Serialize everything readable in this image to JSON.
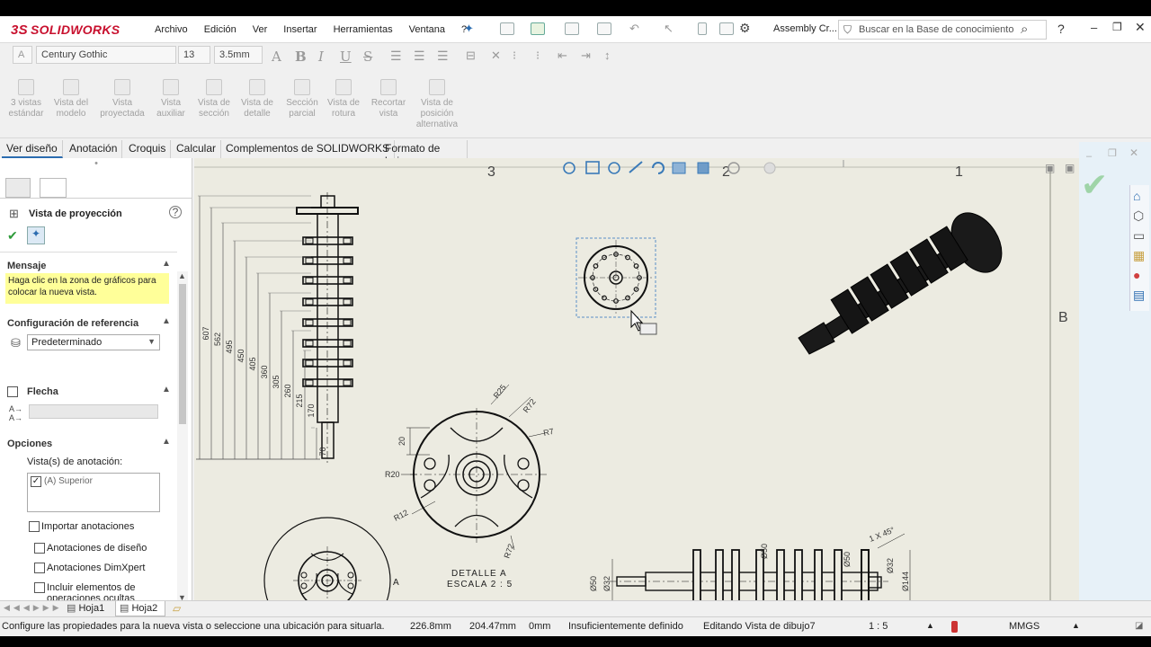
{
  "app": {
    "brand_ds": "3S",
    "brand": "SOLIDWORKS"
  },
  "menu": [
    "Archivo",
    "Edición",
    "Ver",
    "Insertar",
    "Herramientas",
    "Ventana",
    "?"
  ],
  "doc_title": "Assembly Cr...",
  "search": {
    "placeholder": "Buscar en la Base de conocimiento"
  },
  "format_bar": {
    "font": "Century Gothic",
    "size": "13",
    "height": "3.5mm",
    "glyphs": [
      "A",
      "B",
      "I",
      "U",
      "S"
    ]
  },
  "commands": [
    {
      "label": "3 vistas estándar"
    },
    {
      "label": "Vista del modelo"
    },
    {
      "label": "Vista proyectada"
    },
    {
      "label": "Vista auxiliar"
    },
    {
      "label": "Vista de sección"
    },
    {
      "label": "Vista de detalle"
    },
    {
      "label": "Sección parcial"
    },
    {
      "label": "Vista de rotura"
    },
    {
      "label": "Recortar vista"
    },
    {
      "label": "Vista de posición alternativa"
    }
  ],
  "tabs": [
    "Ver diseño",
    "Anotación",
    "Croquis",
    "Calcular",
    "Complementos de SOLIDWORKS",
    "Formato de hoja"
  ],
  "panel": {
    "title": "Vista de proyección",
    "message_header": "Mensaje",
    "message": "Haga clic en la zona de gráficos para colocar la nueva vista.",
    "ref_config_header": "Configuración de referencia",
    "ref_config_value": "Predeterminado",
    "arrow_header": "Flecha",
    "options_header": "Opciones",
    "annot_views_label": "Vista(s) de anotación:",
    "annot_view_item": "(A) Superior",
    "import_annotations": "Importar anotaciones",
    "design_annotations": "Anotaciones de diseño",
    "dimxpert_annotations": "Anotaciones DimXpert",
    "hidden_elements": "Incluir elementos de operaciones ocultas"
  },
  "drawing": {
    "zone_numbers": [
      "3",
      "2",
      "1"
    ],
    "zone_letters": [
      "B",
      "A"
    ],
    "dims_left": [
      "607",
      "562",
      "495",
      "450",
      "405",
      "360",
      "305",
      "260",
      "215",
      "170",
      "70"
    ],
    "radii": [
      "R25",
      "R72",
      "R7",
      "R20",
      "R12",
      "R72"
    ],
    "dim_20": "20",
    "detail_label": "DETALLE A",
    "detail_scale": "ESCALA 2 : 5",
    "view_letter": "A",
    "bottom_dims": [
      "Ø50",
      "Ø32",
      "Ø50",
      "Ø50",
      "Ø32",
      "Ø144"
    ],
    "chamfer": "1 X 45°"
  },
  "sheets": [
    "Hoja1",
    "Hoja2"
  ],
  "status": {
    "message": "Configure las propiedades para la nueva vista o seleccione una ubicación para situarla.",
    "x": "226.8mm",
    "y": "204.47mm",
    "z": "0mm",
    "state": "Insuficientemente definido",
    "editing": "Editando Vista de dibujo7",
    "scale": "1 : 5",
    "units": "MMGS"
  },
  "colors": {
    "accent": "#2b6cb0",
    "brand": "#c8102e",
    "message_bg": "#ffff99",
    "sheet": "#ecebe1"
  }
}
